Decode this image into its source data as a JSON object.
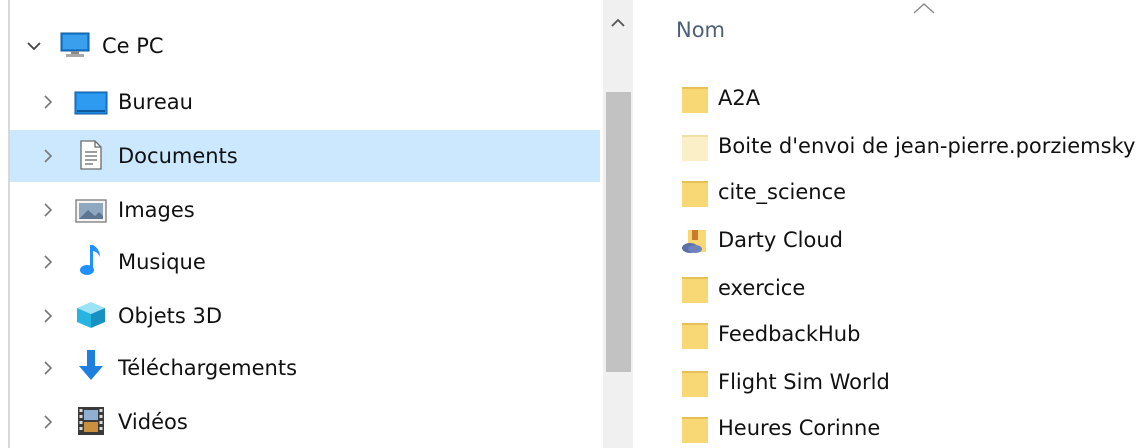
{
  "navigation": {
    "root": {
      "label": "Ce PC",
      "icon": "computer-icon",
      "expanded": true
    },
    "items": [
      {
        "label": "Bureau",
        "icon": "desktop-icon",
        "selected": false
      },
      {
        "label": "Documents",
        "icon": "documents-icon",
        "selected": true
      },
      {
        "label": "Images",
        "icon": "pictures-icon",
        "selected": false
      },
      {
        "label": "Musique",
        "icon": "music-icon",
        "selected": false
      },
      {
        "label": "Objets 3D",
        "icon": "3d-objects-icon",
        "selected": false
      },
      {
        "label": "Téléchargements",
        "icon": "downloads-icon",
        "selected": false
      },
      {
        "label": "Vidéos",
        "icon": "videos-icon",
        "selected": false
      }
    ],
    "selection_color": "#cce8ff"
  },
  "file_list": {
    "column_header": "Nom",
    "sort": "ascending",
    "items": [
      {
        "name": "A2A",
        "icon": "folder-icon"
      },
      {
        "name": "Boite d'envoi de jean-pierre.porziemsky",
        "icon": "folder-faded-icon"
      },
      {
        "name": "cite_science",
        "icon": "folder-icon"
      },
      {
        "name": "Darty Cloud",
        "icon": "cloud-folder-icon"
      },
      {
        "name": "exercice",
        "icon": "folder-icon"
      },
      {
        "name": "FeedbackHub",
        "icon": "folder-icon"
      },
      {
        "name": "Flight Sim World",
        "icon": "folder-icon"
      },
      {
        "name": "Heures Corinne",
        "icon": "folder-icon"
      }
    ]
  },
  "colors": {
    "folder": "#f8d775",
    "header_text": "#4c607a",
    "scrollbar_thumb": "#c2c2c2"
  }
}
